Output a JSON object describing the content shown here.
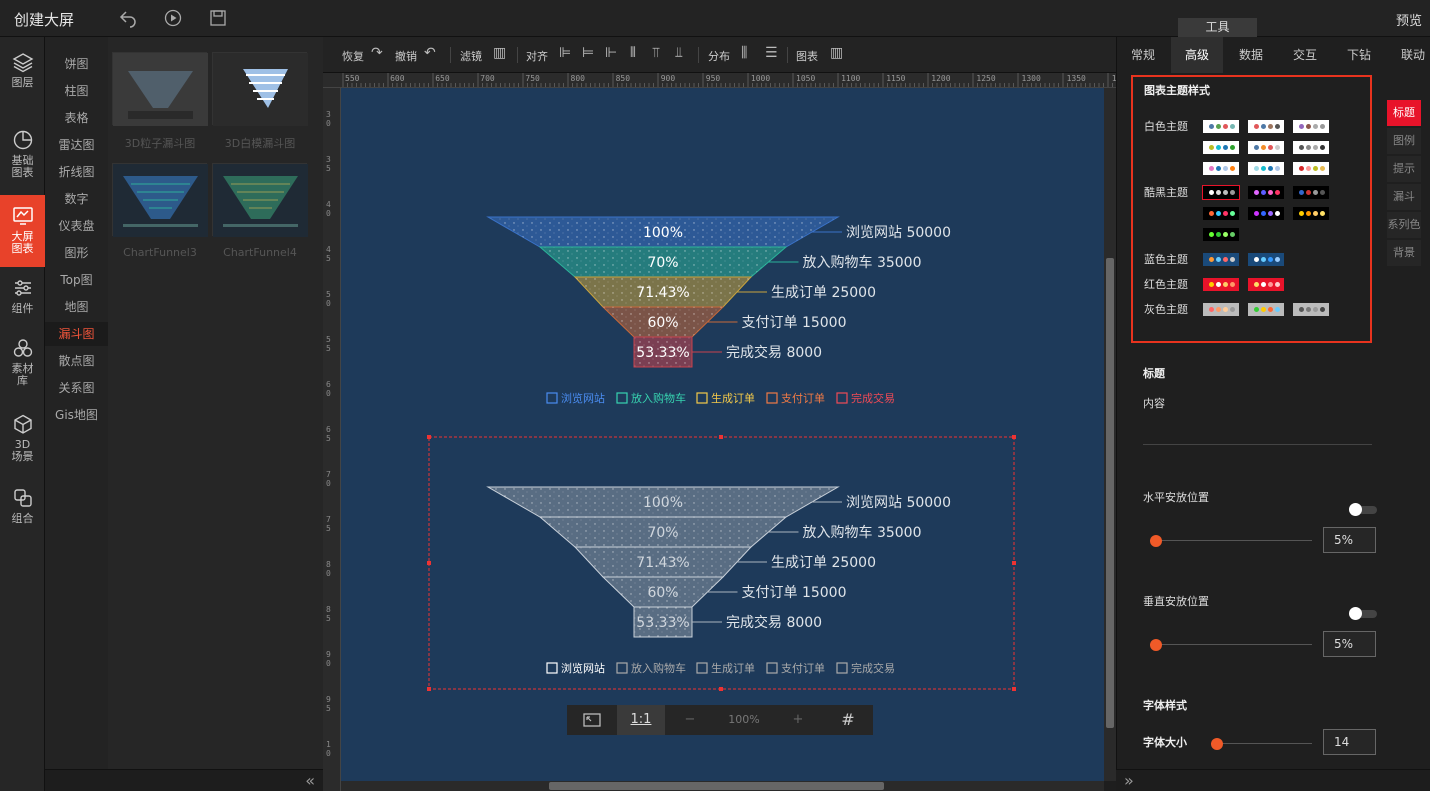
{
  "topbar": {
    "title": "创建大屏",
    "tools_tab": "工具",
    "preview": "预览"
  },
  "leftnav": [
    {
      "label": "图层",
      "icon": "layers-icon"
    },
    {
      "label": "基础图表",
      "icon": "pie-icon"
    },
    {
      "label": "大屏图表",
      "icon": "chart-screen-icon",
      "active": true
    },
    {
      "label": "组件",
      "icon": "sliders-icon"
    },
    {
      "label": "素材库",
      "icon": "material-icon"
    },
    {
      "label": "3D场景",
      "icon": "cube-icon"
    },
    {
      "label": "组合",
      "icon": "group-icon"
    }
  ],
  "categories": [
    "饼图",
    "柱图",
    "表格",
    "雷达图",
    "折线图",
    "数字",
    "仪表盘",
    "图形",
    "Top图",
    "地图",
    "漏斗图",
    "散点图",
    "关系图",
    "Gis地图"
  ],
  "active_category": "漏斗图",
  "thumbnails": [
    "3D粒子漏斗图",
    "3D白模漏斗图",
    "ChartFunnel3",
    "ChartFunnel4"
  ],
  "toolbar": {
    "redo": "恢复",
    "undo": "撤销",
    "filter": "滤镜",
    "align": "对齐",
    "distribute": "分布",
    "chart": "图表"
  },
  "ruler_top": [
    "550",
    "600",
    "650",
    "700",
    "750",
    "800",
    "850",
    "900",
    "950",
    "1000",
    "1050",
    "1100",
    "1150",
    "1200",
    "1250",
    "1300",
    "1350",
    "14"
  ],
  "ruler_left": [
    "3 0",
    "3 5",
    "4 0",
    "4 5",
    "5 0",
    "5 5",
    "6 0",
    "6 5",
    "7 0",
    "7 5",
    "8 0",
    "8 5",
    "9 0",
    "9 5",
    "1 0"
  ],
  "funnel1": {
    "stages": [
      {
        "pct": "100%",
        "label": "浏览网站",
        "value": "50000",
        "color": "#3a72c8"
      },
      {
        "pct": "70%",
        "label": "放入购物车",
        "value": "35000",
        "color": "#2bb39a"
      },
      {
        "pct": "71.43%",
        "label": "生成订单",
        "value": "25000",
        "color": "#c9a43e"
      },
      {
        "pct": "60%",
        "label": "支付订单",
        "value": "15000",
        "color": "#c8693a"
      },
      {
        "pct": "53.33%",
        "label": "完成交易",
        "value": "8000",
        "color": "#c8434e"
      }
    ],
    "legend": [
      "浏览网站",
      "放入购物车",
      "生成订单",
      "支付订单",
      "完成交易"
    ],
    "legend_colors": [
      "#4a8cf0",
      "#37d3b0",
      "#f3c94a",
      "#f07a45",
      "#f04a56"
    ]
  },
  "funnel2": {
    "stages": [
      {
        "pct": "100%",
        "label": "浏览网站",
        "value": "50000"
      },
      {
        "pct": "70%",
        "label": "放入购物车",
        "value": "35000"
      },
      {
        "pct": "71.43%",
        "label": "生成订单",
        "value": "25000"
      },
      {
        "pct": "60%",
        "label": "支付订单",
        "value": "15000"
      },
      {
        "pct": "53.33%",
        "label": "完成交易",
        "value": "8000"
      }
    ],
    "legend": [
      "浏览网站",
      "放入购物车",
      "生成订单",
      "支付订单",
      "完成交易"
    ]
  },
  "zoombar": {
    "fit": "⤢",
    "one_to_one": "1:1",
    "minus": "−",
    "zoom": "100%",
    "plus": "+",
    "grid": "#"
  },
  "rightpanel": {
    "tabs": [
      "常规",
      "高级",
      "数据",
      "交互",
      "下钻",
      "联动"
    ],
    "active_tab": "高级",
    "theme_title": "图表主题样式",
    "themes": [
      {
        "label": "白色主题"
      },
      {
        "label": "酷黑主题"
      },
      {
        "label": "蓝色主题"
      },
      {
        "label": "红色主题"
      },
      {
        "label": "灰色主题"
      }
    ],
    "vtabs": [
      "标题",
      "图例",
      "提示",
      "漏斗",
      "系列色",
      "背景"
    ],
    "title_section": "标题",
    "content_label": "内容",
    "h_pos_label": "水平安放位置",
    "h_pos_value": "5%",
    "v_pos_label": "垂直安放位置",
    "v_pos_value": "5%",
    "font_style_label": "字体样式",
    "font_size_label": "字体大小",
    "font_size_value": "14"
  }
}
